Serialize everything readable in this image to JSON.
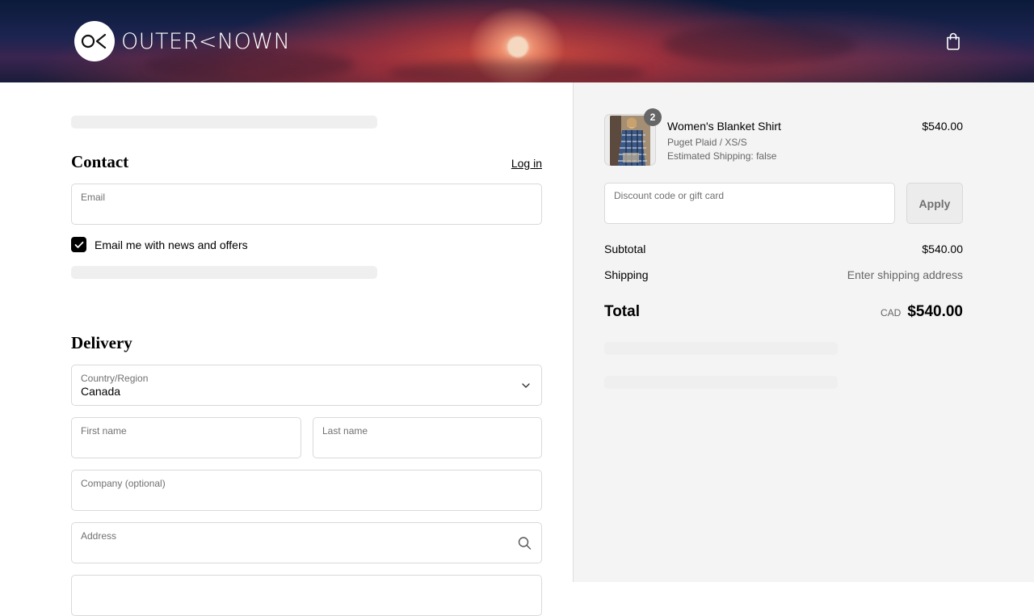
{
  "header": {
    "brand_name": "OUTER<NOWN",
    "logo_mark": "OK",
    "cart_icon": "shopping-bag-icon"
  },
  "contact": {
    "heading": "Contact",
    "login_link": "Log in",
    "email": {
      "label": "Email",
      "value": ""
    },
    "marketing_opt_in": {
      "label": "Email me with news and offers",
      "checked": true
    }
  },
  "delivery": {
    "heading": "Delivery",
    "country": {
      "label": "Country/Region",
      "value": "Canada",
      "icon": "chevron-down-icon"
    },
    "first_name": {
      "label": "First name",
      "value": ""
    },
    "last_name": {
      "label": "Last name",
      "value": ""
    },
    "company": {
      "label": "Company (optional)",
      "value": ""
    },
    "address": {
      "label": "Address",
      "value": "",
      "icon": "search-icon"
    }
  },
  "summary": {
    "item": {
      "name": "Women's Blanket Shirt",
      "variant": "Puget Plaid / XS/S",
      "shipping_note": "Estimated Shipping: false",
      "price": "$540.00",
      "quantity": "2"
    },
    "discount": {
      "label": "Discount code or gift card",
      "value": "",
      "button": "Apply"
    },
    "subtotal_label": "Subtotal",
    "subtotal_value": "$540.00",
    "shipping_label": "Shipping",
    "shipping_value": "Enter shipping address",
    "total_label": "Total",
    "currency": "CAD",
    "total_value": "$540.00"
  },
  "colors": {
    "accent": "#000000",
    "sidebar_bg": "#f4f4f4",
    "border": "#d9d9d9",
    "muted_text": "#707070"
  }
}
